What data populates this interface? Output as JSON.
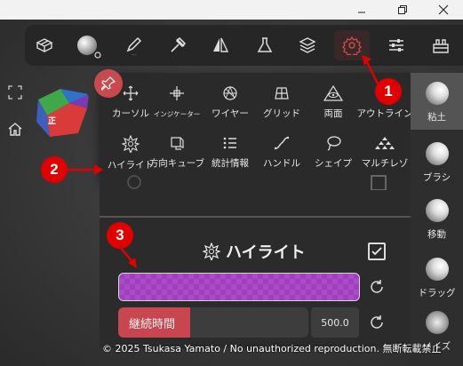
{
  "toolbar": {
    "tools": [
      {
        "name": "mesh-tool",
        "icon": "mesh-icon"
      },
      {
        "name": "material-tool",
        "icon": "material-ball-icon"
      },
      {
        "name": "brush-tool",
        "icon": "pen-icon"
      },
      {
        "name": "stamp-tool",
        "icon": "hammer-icon"
      },
      {
        "name": "symmetry-tool",
        "icon": "symmetry-icon"
      },
      {
        "name": "flask-tool",
        "icon": "flask-icon"
      },
      {
        "name": "layers-tool",
        "icon": "layers-icon"
      },
      {
        "name": "settings-tool",
        "icon": "gear-icon"
      },
      {
        "name": "sliders-tool",
        "icon": "sliders-icon"
      },
      {
        "name": "tools-tool",
        "icon": "toolbox-icon"
      }
    ]
  },
  "view_cube": {
    "front_label": "正"
  },
  "popup": {
    "row1": [
      {
        "label": "カーソル",
        "icon": "cursor-move-icon"
      },
      {
        "label": "インジケーター",
        "icon": "crosshair-icon"
      },
      {
        "label": "ワイヤー",
        "icon": "wireframe-icon"
      },
      {
        "label": "グリッド",
        "icon": "grid-icon"
      },
      {
        "label": "両面",
        "icon": "eye-triangle-icon"
      },
      {
        "label": "アウトライン",
        "icon": "outline-icon"
      }
    ],
    "row2": [
      {
        "label": "ハイライト",
        "icon": "highlight-icon"
      },
      {
        "label": "方向キューブ",
        "icon": "direction-cube-icon"
      },
      {
        "label": "統計情報",
        "icon": "stats-list-icon"
      },
      {
        "label": "ハンドル",
        "icon": "handle-curve-icon"
      },
      {
        "label": "シェイプ",
        "icon": "lasso-icon"
      },
      {
        "label": "マルチレゾ",
        "icon": "pyramid-icon"
      }
    ]
  },
  "panel": {
    "section_title": "ハイライト",
    "checked": true,
    "color_hex": "#a23fbf",
    "slider_label": "継続時間",
    "slider_value": "500.0",
    "slider_fraction": 0.38
  },
  "right_panel": {
    "items": [
      {
        "label": "粘土",
        "active": true
      },
      {
        "label": "ブラシ",
        "active": false
      },
      {
        "label": "移動",
        "active": false
      },
      {
        "label": "ドラッグ",
        "active": false
      },
      {
        "label": "ノイズ",
        "active": false
      }
    ]
  },
  "markers": [
    "1",
    "2",
    "3"
  ],
  "copyright": "© 2025 Tsukasa Yamato / No unauthorized reproduction. 無断転載禁止",
  "colors": {
    "accent": "#c94a4e",
    "marker": "#e10000",
    "highlight": "#a23fbf"
  }
}
